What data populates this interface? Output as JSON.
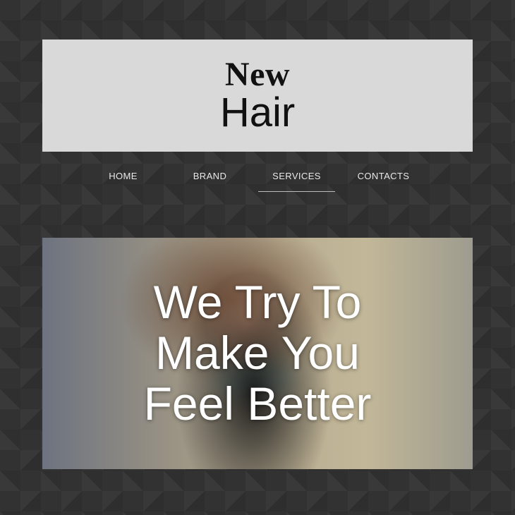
{
  "logo": {
    "line1": "New",
    "line2": "Hair"
  },
  "nav": {
    "items": [
      {
        "label": "HOME"
      },
      {
        "label": "BRAND"
      },
      {
        "label": "SERVICES"
      },
      {
        "label": "CONTACTS"
      }
    ],
    "active_index": 2
  },
  "hero": {
    "lines": [
      "We Try To",
      "Make You",
      "Feel Better"
    ]
  },
  "colors": {
    "page_background": "#323232",
    "header_background": "#d9d9d9",
    "nav_text": "#e9e9e9",
    "hero_text": "#ffffff"
  }
}
